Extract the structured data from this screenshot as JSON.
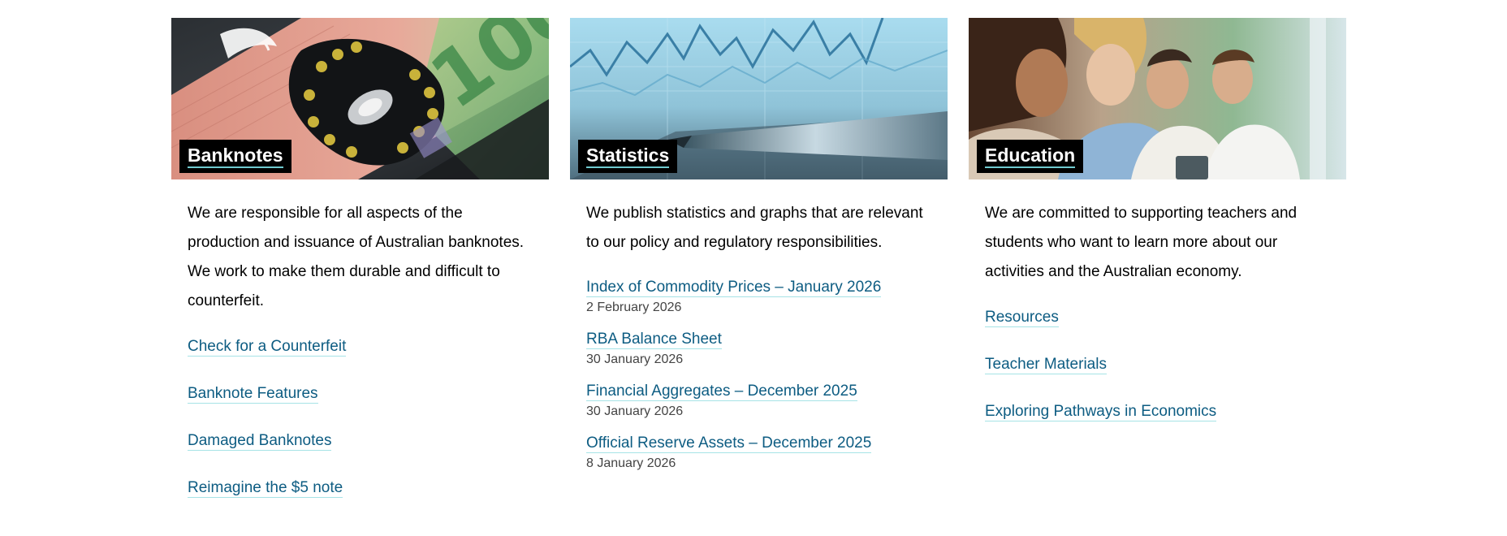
{
  "cards": [
    {
      "title": "Banknotes",
      "description": "We are responsible for all aspects of the production and issuance of Australian banknotes. We work to make them durable and difficult to counterfeit.",
      "image_icon": "banknote-image",
      "links": [
        {
          "label": "Check for a Counterfeit"
        },
        {
          "label": "Banknote Features"
        },
        {
          "label": "Damaged Banknotes"
        },
        {
          "label": "Reimagine the $5 note"
        }
      ]
    },
    {
      "title": "Statistics",
      "description": "We publish statistics and graphs that are relevant to our policy and regulatory responsibilities.",
      "image_icon": "statistics-chart-image",
      "links": [
        {
          "label": "Index of Commodity Prices – January 2026",
          "date": "2 February 2026"
        },
        {
          "label": "RBA Balance Sheet",
          "date": "30 January 2026"
        },
        {
          "label": "Financial Aggregates – December 2025",
          "date": "30 January 2026"
        },
        {
          "label": "Official Reserve Assets – December 2025",
          "date": "8 January 2026"
        }
      ]
    },
    {
      "title": "Education",
      "description": "We are committed to supporting teachers and students who want to learn more about our activities and the Australian economy.",
      "image_icon": "students-image",
      "links": [
        {
          "label": "Resources"
        },
        {
          "label": "Teacher Materials"
        },
        {
          "label": "Exploring Pathways in Economics"
        }
      ]
    }
  ],
  "colors": {
    "link": "#0d5c82",
    "link_underline": "#a6e3e6",
    "label_bg": "#000000",
    "label_underline": "#6fc9cf",
    "date": "#444444"
  }
}
